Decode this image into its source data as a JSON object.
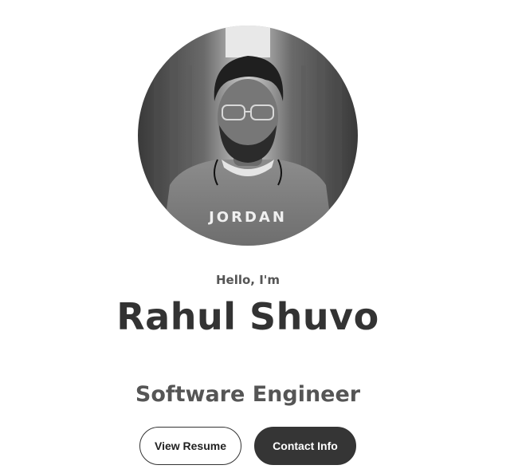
{
  "hero": {
    "profile_image": "profile-photo",
    "shirt_text": "JORDAN",
    "greeting": "Hello, I'm",
    "name": "Rahul Shuvo",
    "role": "Software Engineer"
  },
  "actions": {
    "resume_label": "View Resume",
    "contact_label": "Contact Info"
  },
  "colors": {
    "text": "#333333",
    "muted_text": "#555555",
    "dark_button": "#353535",
    "background": "#ffffff"
  }
}
